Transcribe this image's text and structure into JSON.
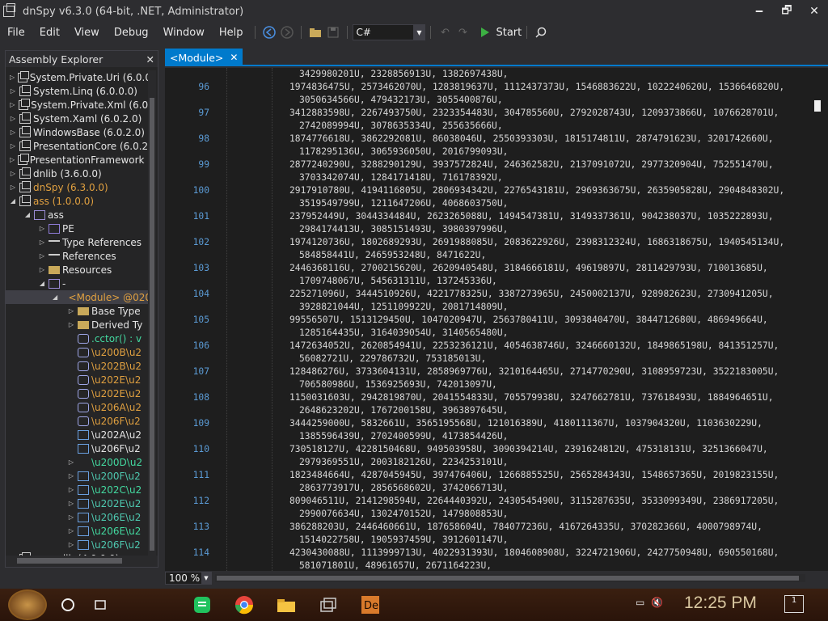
{
  "window": {
    "title": "dnSpy v6.3.0 (64-bit, .NET, Administrator)",
    "minimize": "🗕",
    "maximize": "🗗",
    "close": "✕"
  },
  "menu": [
    "File",
    "Edit",
    "View",
    "Debug",
    "Window",
    "Help"
  ],
  "toolbar": {
    "language": "C#",
    "start_label": "Start"
  },
  "explorer": {
    "title": "Assembly Explorer",
    "items": [
      {
        "label": "System.Private.Uri (6.0.0",
        "arrow": "▷",
        "icon": "assembly-icon",
        "style": "dark",
        "indent": 0
      },
      {
        "label": "System.Linq (6.0.0.0)",
        "arrow": "▷",
        "icon": "assembly-icon",
        "style": "dark",
        "indent": 0
      },
      {
        "label": "System.Private.Xml (6.0.",
        "arrow": "▷",
        "icon": "assembly-icon",
        "style": "dark",
        "indent": 0
      },
      {
        "label": "System.Xaml (6.0.2.0)",
        "arrow": "▷",
        "icon": "assembly-icon",
        "style": "dark",
        "indent": 0
      },
      {
        "label": "WindowsBase (6.0.2.0)",
        "arrow": "▷",
        "icon": "assembly-icon",
        "style": "dark",
        "indent": 0
      },
      {
        "label": "PresentationCore (6.0.2.",
        "arrow": "▷",
        "icon": "assembly-icon",
        "style": "dark",
        "indent": 0
      },
      {
        "label": "PresentationFramework (",
        "arrow": "▷",
        "icon": "assembly-icon",
        "style": "dark",
        "indent": 0
      },
      {
        "label": "dnlib (3.6.0.0)",
        "arrow": "▷",
        "icon": "assembly-icon",
        "style": "dark",
        "indent": 0
      },
      {
        "label": "dnSpy (6.3.0.0)",
        "arrow": "▷",
        "icon": "assembly-icon",
        "style": "gold",
        "indent": 0
      },
      {
        "label": "ass (1.0.0.0)",
        "arrow": "◢",
        "icon": "assembly-icon",
        "style": "gold",
        "indent": 0
      },
      {
        "label": "ass",
        "arrow": "◢",
        "icon": "module-icon",
        "style": "dark",
        "indent": 1
      },
      {
        "label": "PE",
        "arrow": "▷",
        "icon": "pe-icon",
        "style": "dark",
        "indent": 2
      },
      {
        "label": "Type References",
        "arrow": "▷",
        "icon": "type-references-icon",
        "style": "dark",
        "indent": 2
      },
      {
        "label": "References",
        "arrow": "▷",
        "icon": "references-icon",
        "style": "dark",
        "indent": 2
      },
      {
        "label": "Resources",
        "arrow": "▷",
        "icon": "folder-icon",
        "style": "dark",
        "indent": 2
      },
      {
        "label": "-",
        "arrow": "◢",
        "icon": "namespace-icon",
        "style": "dark",
        "indent": 2
      },
      {
        "label": "<Module> @020",
        "arrow": "◢",
        "icon": "class-icon",
        "style": "gold",
        "indent": 3,
        "selected": true
      },
      {
        "label": "Base Type",
        "arrow": "▷",
        "icon": "folder-icon",
        "style": "dark",
        "indent": 4
      },
      {
        "label": "Derived Ty",
        "arrow": "▷",
        "icon": "folder-icon",
        "style": "dark",
        "indent": 4
      },
      {
        "label": ".cctor() : v",
        "arrow": "",
        "icon": "method-icon",
        "style": "green",
        "indent": 4
      },
      {
        "label": "\\u200B\\u2",
        "arrow": "",
        "icon": "method-icon",
        "style": "gold",
        "indent": 4
      },
      {
        "label": "\\u202B\\u2",
        "arrow": "",
        "icon": "method-icon",
        "style": "gold",
        "indent": 4
      },
      {
        "label": "\\u202E\\u2",
        "arrow": "",
        "icon": "method-icon",
        "style": "gold",
        "indent": 4
      },
      {
        "label": "\\u202E\\u2",
        "arrow": "",
        "icon": "method-icon",
        "style": "gold",
        "indent": 4
      },
      {
        "label": "\\u206A\\u2",
        "arrow": "",
        "icon": "method-icon",
        "style": "gold",
        "indent": 4
      },
      {
        "label": "\\u206F\\u2",
        "arrow": "",
        "icon": "method-icon",
        "style": "gold",
        "indent": 4
      },
      {
        "label": "\\u202A\\u2",
        "arrow": "",
        "icon": "field-icon",
        "style": "dark",
        "indent": 4
      },
      {
        "label": "\\u206F\\u2",
        "arrow": "",
        "icon": "field-icon",
        "style": "dark",
        "indent": 4
      },
      {
        "label": "\\u200D\\u2",
        "arrow": "▷",
        "icon": "class-icon",
        "style": "green",
        "indent": 4
      },
      {
        "label": "\\u200F\\u2",
        "arrow": "▷",
        "icon": "struct-icon",
        "style": "teal",
        "indent": 4
      },
      {
        "label": "\\u202C\\u2",
        "arrow": "▷",
        "icon": "struct-icon",
        "style": "green",
        "indent": 4
      },
      {
        "label": "\\u202E\\u2",
        "arrow": "▷",
        "icon": "struct-icon",
        "style": "teal",
        "indent": 4
      },
      {
        "label": "\\u206E\\u2",
        "arrow": "▷",
        "icon": "struct-icon",
        "style": "teal",
        "indent": 4
      },
      {
        "label": "\\u206E\\u2",
        "arrow": "▷",
        "icon": "struct-icon",
        "style": "green",
        "indent": 4
      },
      {
        "label": "\\u206F\\u2",
        "arrow": "▷",
        "icon": "struct-icon",
        "style": "teal",
        "indent": 4
      },
      {
        "label": "mscorlib (4.0.0.0)",
        "arrow": "▷",
        "icon": "assembly-icon",
        "style": "dark",
        "indent": 0
      }
    ]
  },
  "editor": {
    "tab_label": "<Module>",
    "zoom": "100 %",
    "lines": [
      {
        "num": "",
        "text": "3429980201U, 2328856913U, 1382697438U,",
        "cont": true
      },
      {
        "num": "96",
        "text": "1974836475U, 2573462070U, 1283819637U, 1112437373U, 1546883622U, 1022240620U, 1536646820U,"
      },
      {
        "num": "",
        "text": "3050634566U, 479432173U, 3055400876U,",
        "cont": true
      },
      {
        "num": "97",
        "text": "3412883598U, 2267493750U, 2323354483U, 304785560U, 2792028743U, 1209373866U, 1076628701U,"
      },
      {
        "num": "",
        "text": "2742089994U, 3078635334U, 255635666U,",
        "cont": true
      },
      {
        "num": "98",
        "text": "1874776618U, 3862292081U, 86038046U, 2550393303U, 1815174811U, 2874791623U, 3201742660U,"
      },
      {
        "num": "",
        "text": "1178295136U, 3065936050U, 2016799093U,",
        "cont": true
      },
      {
        "num": "99",
        "text": "2877240290U, 3288290129U, 3937572824U, 246362582U, 2137091072U, 2977320904U, 752551470U,"
      },
      {
        "num": "",
        "text": "3703342074U, 1284171418U, 716178392U,",
        "cont": true
      },
      {
        "num": "100",
        "text": "2917910780U, 4194116805U, 2806934342U, 2276543181U, 2969363675U, 2635905828U, 2904848302U,"
      },
      {
        "num": "",
        "text": "3519549799U, 1211647206U, 4068603750U,",
        "cont": true
      },
      {
        "num": "101",
        "text": "237952449U, 3044334484U, 2623265088U, 1494547381U, 3149337361U, 904238037U, 1035222893U,"
      },
      {
        "num": "",
        "text": "2984174413U, 3085151493U, 3980397996U,",
        "cont": true
      },
      {
        "num": "102",
        "text": "1974120736U, 1802689293U, 2691988085U, 2083622926U, 2398312324U, 1686318675U, 1940545134U,"
      },
      {
        "num": "",
        "text": "584858441U, 2465953248U, 8471622U,",
        "cont": true
      },
      {
        "num": "103",
        "text": "2446368116U, 2700215620U, 2620940548U, 3184666181U, 49619897U, 2811429793U, 710013685U,"
      },
      {
        "num": "",
        "text": "1709748067U, 545631311U, 137245336U,",
        "cont": true
      },
      {
        "num": "104",
        "text": "225271096U, 3444510926U, 4221778325U, 3387273965U, 2450002137U, 928982623U, 2730941205U,"
      },
      {
        "num": "",
        "text": "3928821044U, 1251109922U, 2081714809U,",
        "cont": true
      },
      {
        "num": "105",
        "text": "99556507U, 1513129450U, 1047020947U, 2563780411U, 3093840470U, 3844712680U, 486949664U,"
      },
      {
        "num": "",
        "text": "1285164435U, 3164039054U, 3140565480U,",
        "cont": true
      },
      {
        "num": "106",
        "text": "1472634052U, 2620854941U, 2253236121U, 4054638746U, 3246660132U, 1849865198U, 841351257U,"
      },
      {
        "num": "",
        "text": "56082721U, 229786732U, 753185013U,",
        "cont": true
      },
      {
        "num": "107",
        "text": "128486276U, 3733604131U, 2858969776U, 3210164465U, 2714770290U, 3108959723U, 3522183005U,"
      },
      {
        "num": "",
        "text": "706580986U, 1536925693U, 742013097U,",
        "cont": true
      },
      {
        "num": "108",
        "text": "1150031603U, 2942819870U, 2041554833U, 705579938U, 3247662781U, 737618493U, 1884964651U,"
      },
      {
        "num": "",
        "text": "2648623202U, 1767200158U, 3963897645U,",
        "cont": true
      },
      {
        "num": "109",
        "text": "3444259000U, 5832661U, 3565195568U, 121016389U, 4180111367U, 1037904320U, 1103630229U,"
      },
      {
        "num": "",
        "text": "1385596439U, 2702400599U, 4173854426U,",
        "cont": true
      },
      {
        "num": "110",
        "text": "730518127U, 4228150468U, 949503958U, 3090394214U, 2391624812U, 475318131U, 3251366047U,"
      },
      {
        "num": "",
        "text": "2979369551U, 2003182126U, 2234253101U,",
        "cont": true
      },
      {
        "num": "111",
        "text": "1823484664U, 4287045945U, 397476406U, 1266885525U, 2565284343U, 1548657365U, 2019823155U,"
      },
      {
        "num": "",
        "text": "2863773917U, 2856568602U, 3742066713U,",
        "cont": true
      },
      {
        "num": "112",
        "text": "809046511U, 2141298594U, 2264440392U, 2430545490U, 3115287635U, 3533099349U, 2386917205U,"
      },
      {
        "num": "",
        "text": "2990076634U, 1302470152U, 1479808853U,",
        "cont": true
      },
      {
        "num": "113",
        "text": "386288203U, 2446460661U, 187658604U, 784077236U, 4167264335U, 370282366U, 4000798974U,"
      },
      {
        "num": "",
        "text": "1514022758U, 1905937459U, 3912601147U,",
        "cont": true
      },
      {
        "num": "114",
        "text": "4230430088U, 1113999713U, 4022931393U, 1804608908U, 3224721906U, 2427750948U, 690550168U,"
      },
      {
        "num": "",
        "text": "581071801U, 48961657U, 2671164223U,",
        "cont": true
      }
    ]
  },
  "taskbar": {
    "time": "12:25 PM",
    "notification_count": "1"
  },
  "colors": {
    "accent": "#007acc",
    "line_number": "#5b9bd5",
    "gold": "#e0a040",
    "green": "#43d9a0"
  }
}
